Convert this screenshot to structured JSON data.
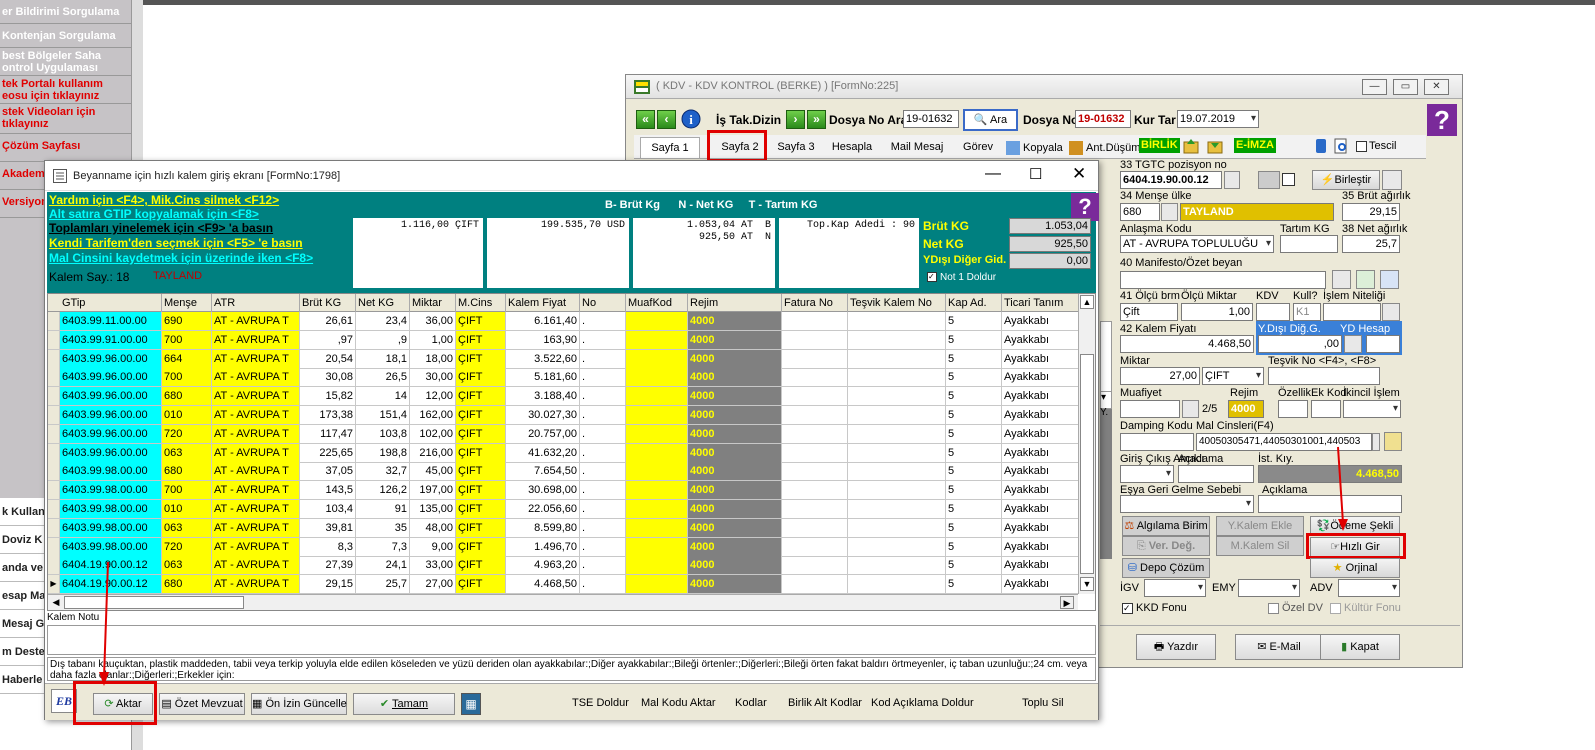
{
  "left_menu": {
    "items": [
      {
        "label": "er Bildirimi Sorgulama",
        "color": "white"
      },
      {
        "label": "Kontenjan Sorgulama",
        "color": "white"
      },
      {
        "label": "best Bölgeler Saha\nontrol Uygulaması",
        "color": "white"
      },
      {
        "label": "tek Portalı kullanım\neosu için tıklayınız",
        "color": "red"
      },
      {
        "label": "stek Videoları için\ntıklayınız",
        "color": "red"
      },
      {
        "label": "Çözüm Sayfası",
        "color": "red"
      },
      {
        "label": "Akademi",
        "color": "red"
      },
      {
        "label": "Versiyon",
        "color": "red"
      }
    ],
    "lower_items": [
      "k Kullan",
      "Doviz K",
      "anda ve",
      "esap Ma",
      "Mesaj G",
      "m Deste",
      "Haberle"
    ]
  },
  "kdv_window": {
    "title": "( KDV - KDV KONTROL (BERKE) ) [FormNo:225]",
    "toolbar": {
      "is_tak_dizin": "İş Tak.Dizin",
      "dosya_no_ara_label": "Dosya No Ara",
      "dosya_no_ara_value": "19-01632",
      "ara_button": "Ara",
      "dosya_no_label": "Dosya No",
      "dosya_no_value": "19-01632",
      "kur_tar_label": "Kur Tar",
      "kur_tar_value": "19.07.2019"
    },
    "tabs": [
      "Sayfa 1",
      "Sayfa 2",
      "Sayfa 3",
      "Hesapla",
      "Mail Mesaj",
      "Görev",
      "Kopyala",
      "Ant.Düşüm",
      "BİRLİK",
      "E-İMZA",
      "Tescil"
    ],
    "fields": {
      "tgtc_label": "33 TGTC pozisyon no",
      "tgtc_value": "6404.19.90.00.12",
      "birlestir": "Birleştir",
      "mense_label": "34 Menşe ülke",
      "mense_code": "680",
      "mense_name": "TAYLAND",
      "brut_label": "35 Brüt ağırlık",
      "brut_value": "29,15",
      "anlasma_label": "Anlaşma Kodu",
      "anlasma_value": "AT   - AVRUPA TOPLULUĞU",
      "tartim_label": "Tartım KG",
      "net_label": "38 Net ağırlık",
      "net_value": "25,7",
      "manifesto_label": "40 Manifesto/Özet beyan",
      "olcu_brm_label": "41 Ölçü brm",
      "olcu_miktar_label": "Ölçü Miktar",
      "kdv_label": "KDV",
      "kull_label": "Kull?",
      "islem_nit_label": "İşlem Niteliği",
      "olcu_brm_value": "Çift",
      "olcu_miktar_value": "1,00",
      "kdv_value": "K1",
      "kalem_fiyati_label": "42 Kalem Fiyatı",
      "kalem_fiyati_value": "4.468,50",
      "ydisi_dig_label": "Y.Dışı Diğ.G.",
      "ydisi_dig_value": ",00",
      "yd_hesap_label": "YD Hesap",
      "miktar_label": "Miktar",
      "miktar_value": "27,00",
      "miktar_unit": "ÇIFT",
      "tesvik_label": "Teşvik No <F4>, <F8>",
      "muafiyet_label": "Muafiyet",
      "muafiyet_value": "2/5",
      "rejim_label": "Rejim",
      "rejim_value": "4000",
      "ozellik_label": "Özellik",
      "ek_kod_label": "Ek Kod",
      "ikincil_label": "İkincil İşlem",
      "damping_label": "Damping Kodu",
      "mal_cinsleri_label": "Mal Cinsleri(F4)",
      "mal_cinsleri_value": "40050305471,44050301001,440503",
      "giris_cikis_label": "Giriş Çıkış Amacı",
      "aciklama_label": "Açıklama",
      "ist_kiy_label": "İst. Kıy.",
      "ist_kiy_value": "4.468,50",
      "esya_geri_label": "Eşya Geri Gelme Sebebi",
      "aciklama2_label": "Açıklama",
      "igv_label": "İGV",
      "emy_label": "EMY",
      "adv_label": "ADV",
      "kkd_fonu": "KKD Fonu",
      "ozel_dv": "Özel DV",
      "kultur_fonu": "Kültür Fonu"
    },
    "buttons": {
      "algilama_birim": "Algılama Birim",
      "y_kalem_ekle": "Y.Kalem Ekle",
      "odeme_sekli": "Ödeme Şekli",
      "ver_deg": "Ver. Değ.",
      "m_kalem_sil": "M.Kalem Sil",
      "hizli_gir": "Hızlı Gir",
      "depo_cozum": "Depo Çözüm",
      "orjinal": "Orjinal",
      "yazdir": "Yazdır",
      "email": "E-Mail",
      "kapat": "Kapat"
    },
    "left_fragment": [
      "Y."
    ]
  },
  "dialog": {
    "title": "Beyanname için hızlı kalem giriş ekranı [FormNo:1798]",
    "help_lines": [
      {
        "text": "Yardım için <F4>, Mik.Cins silmek <F12>",
        "color": "y"
      },
      {
        "text": "Alt satıra GTIP kopyalamak için <F8>",
        "color": "c"
      },
      {
        "text": "Toplamları yinelemek için <F9> 'a basın",
        "color": "k"
      },
      {
        "text": "Kendi Tarifem'den seçmek  için <F5> 'e basın",
        "color": "y"
      },
      {
        "text": "Mal Cinsini kaydetmek için üzerinde iken <F8>",
        "color": "c"
      }
    ],
    "kalem_say_label": "Kalem Say.: 18",
    "kalem_country": "TAYLAND",
    "legend": "B- Brüt Kg      N - Net KG     T - Tartım KG",
    "box1": "1.116,00 ÇIFT",
    "box2": "199.535,70 USD",
    "box3": "1.053,04 AT  B\n  925,50 AT  N",
    "box4": "Top.Kap Adedi : 90",
    "brut_kg_label": "Brüt KG",
    "brut_kg_value": "1.053,04",
    "net_kg_label": "Net KG",
    "net_kg_value": "925,50",
    "ydisi_label": "YDışı Diğer Gid.",
    "ydisi_value": "0,00",
    "not1_doldur": "Not 1 Doldur",
    "columns": [
      "GTip",
      "Menşe",
      "ATR",
      "Brüt KG",
      "Net KG",
      "Miktar",
      "M.Cins",
      "Kalem Fiyat",
      "No",
      "MuafKod",
      "Rejim",
      "Fatura No",
      "Teşvik Kalem No",
      "Kap Ad.",
      "Ticari Tanım"
    ],
    "rows": [
      [
        "6403.99.11.00.00",
        "690",
        "AT    - AVRUPA T",
        "26,61",
        "23,4",
        "36,00",
        "ÇIFT",
        "6.161,40",
        ".",
        "",
        "4000",
        "",
        "",
        "5",
        "Ayakkabı"
      ],
      [
        "6403.99.91.00.00",
        "700",
        "AT    - AVRUPA T",
        ",97",
        ",9",
        "1,00",
        "ÇIFT",
        "163,90",
        ".",
        "",
        "4000",
        "",
        "",
        "5",
        "Ayakkabı"
      ],
      [
        "6403.99.96.00.00",
        "664",
        "AT    - AVRUPA T",
        "20,54",
        "18,1",
        "18,00",
        "ÇIFT",
        "3.522,60",
        ".",
        "",
        "4000",
        "",
        "",
        "5",
        "Ayakkabı"
      ],
      [
        "6403.99.96.00.00",
        "700",
        "AT    - AVRUPA T",
        "30,08",
        "26,5",
        "30,00",
        "ÇIFT",
        "5.181,60",
        ".",
        "",
        "4000",
        "",
        "",
        "5",
        "Ayakkabı"
      ],
      [
        "6403.99.96.00.00",
        "680",
        "AT    - AVRUPA T",
        "15,82",
        "14",
        "12,00",
        "ÇIFT",
        "3.188,40",
        ".",
        "",
        "4000",
        "",
        "",
        "5",
        "Ayakkabı"
      ],
      [
        "6403.99.96.00.00",
        "010",
        "AT    - AVRUPA T",
        "173,38",
        "151,4",
        "162,00",
        "ÇIFT",
        "30.027,30",
        ".",
        "",
        "4000",
        "",
        "",
        "5",
        "Ayakkabı"
      ],
      [
        "6403.99.96.00.00",
        "720",
        "AT    - AVRUPA T",
        "117,47",
        "103,8",
        "102,00",
        "ÇIFT",
        "20.757,00",
        ".",
        "",
        "4000",
        "",
        "",
        "5",
        "Ayakkabı"
      ],
      [
        "6403.99.96.00.00",
        "063",
        "AT    - AVRUPA T",
        "225,65",
        "198,8",
        "216,00",
        "ÇIFT",
        "41.632,20",
        ".",
        "",
        "4000",
        "",
        "",
        "5",
        "Ayakkabı"
      ],
      [
        "6403.99.98.00.00",
        "680",
        "AT    - AVRUPA T",
        "37,05",
        "32,7",
        "45,00",
        "ÇIFT",
        "7.654,50",
        ".",
        "",
        "4000",
        "",
        "",
        "5",
        "Ayakkabı"
      ],
      [
        "6403.99.98.00.00",
        "700",
        "AT    - AVRUPA T",
        "143,5",
        "126,2",
        "197,00",
        "ÇIFT",
        "30.698,00",
        ".",
        "",
        "4000",
        "",
        "",
        "5",
        "Ayakkabı"
      ],
      [
        "6403.99.98.00.00",
        "010",
        "AT    - AVRUPA T",
        "103,4",
        "91",
        "135,00",
        "ÇIFT",
        "22.056,60",
        ".",
        "",
        "4000",
        "",
        "",
        "5",
        "Ayakkabı"
      ],
      [
        "6403.99.98.00.00",
        "063",
        "AT    - AVRUPA T",
        "39,81",
        "35",
        "48,00",
        "ÇIFT",
        "8.599,80",
        ".",
        "",
        "4000",
        "",
        "",
        "5",
        "Ayakkabı"
      ],
      [
        "6403.99.98.00.00",
        "720",
        "AT    - AVRUPA T",
        "8,3",
        "7,3",
        "9,00",
        "ÇIFT",
        "1.496,70",
        ".",
        "",
        "4000",
        "",
        "",
        "5",
        "Ayakkabı"
      ],
      [
        "6404.19.90.00.12",
        "063",
        "AT    - AVRUPA T",
        "27,39",
        "24,1",
        "33,00",
        "ÇIFT",
        "4.963,20",
        ".",
        "",
        "4000",
        "",
        "",
        "5",
        "Ayakkabı"
      ],
      [
        "6404.19.90.00.12",
        "680",
        "AT    - AVRUPA T",
        "29,15",
        "25,7",
        "27,00",
        "ÇIFT",
        "4.468,50",
        ".",
        "",
        "4000",
        "",
        "",
        "5",
        "Ayakkabı"
      ]
    ],
    "kalem_notu_label": "Kalem Notu",
    "description": "Dış tabanı kauçuktan, plastik maddeden, tabii veya terkip yoluyla elde edilen köseleden ve yüzü deriden olan ayakkabılar:;Diğer ayakkabılar:;Bileği örtenler:;Diğerleri:;Bileği örten fakat baldırı örtmeyenler, iç taban uzunluğu:;24 cm. veya daha fazla olanlar:;Diğerleri:;Erkekler için:",
    "buttons": {
      "aktar": "Aktar",
      "ozet_mevzuat": "Özet Mevzuat",
      "on_izin": "Ön İzin Güncelle",
      "tamam": "Tamam"
    },
    "links": [
      "TSE Doldur",
      "Mal Kodu Aktar",
      "Kodlar",
      "Birlik Alt Kodlar",
      "Kod Açıklama Doldur",
      "Toplu Sil"
    ]
  }
}
